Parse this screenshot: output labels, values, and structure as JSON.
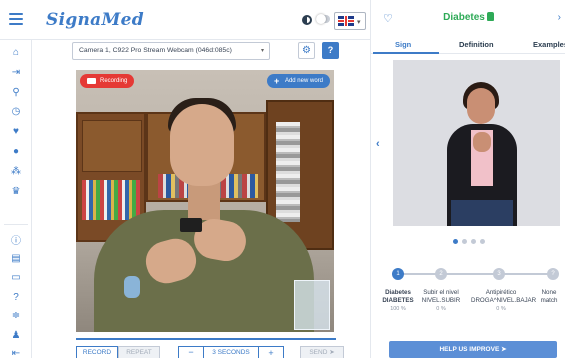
{
  "app": {
    "logo": "SignaMed"
  },
  "header": {
    "language_flag": "uk-flag-icon",
    "language_caret": "▾"
  },
  "sidebar": {
    "icons": [
      "home-icon",
      "login-icon",
      "search-icon",
      "history-icon",
      "heart-icon",
      "circle-icon",
      "group-icon",
      "trophy-icon",
      "info-icon",
      "book-icon",
      "id-card-icon",
      "help-icon",
      "sliders-icon",
      "user-icon",
      "logout-icon"
    ]
  },
  "camera": {
    "selected": "Camera 1, C922 Pro Stream Webcam (046d:085c)",
    "recording_label": "Recording",
    "add_word_label": "Add new word"
  },
  "controls": {
    "record": "RECORD",
    "repeat": "REPEAT",
    "minus": "−",
    "seconds": "3 SECONDS",
    "plus": "+",
    "send": "SEND"
  },
  "panel": {
    "word": "Diabetes",
    "tabs": [
      "Sign",
      "Definition",
      "Examples"
    ],
    "active_tab": "Sign",
    "carousel": {
      "count": 4,
      "active": 0
    },
    "steps": [
      "1",
      "2",
      "3",
      "?"
    ],
    "candidates": [
      {
        "line1": "Diabetes",
        "line2": "DIABETES",
        "pct": "100 %"
      },
      {
        "line1": "Subir el nivel",
        "line2": "NIVEL.SUBIR",
        "pct": "0 %"
      },
      {
        "line1": "Antipirético",
        "line2": "DROGA^NIVEL.BAJAR",
        "pct": "0 %"
      },
      {
        "line1": "None",
        "line2": "match",
        "pct": ""
      }
    ],
    "help_button": "HELP US IMPROVE"
  },
  "colors": {
    "accent": "#3d7bc7",
    "success": "#2eaa57",
    "recording": "#e53935"
  }
}
